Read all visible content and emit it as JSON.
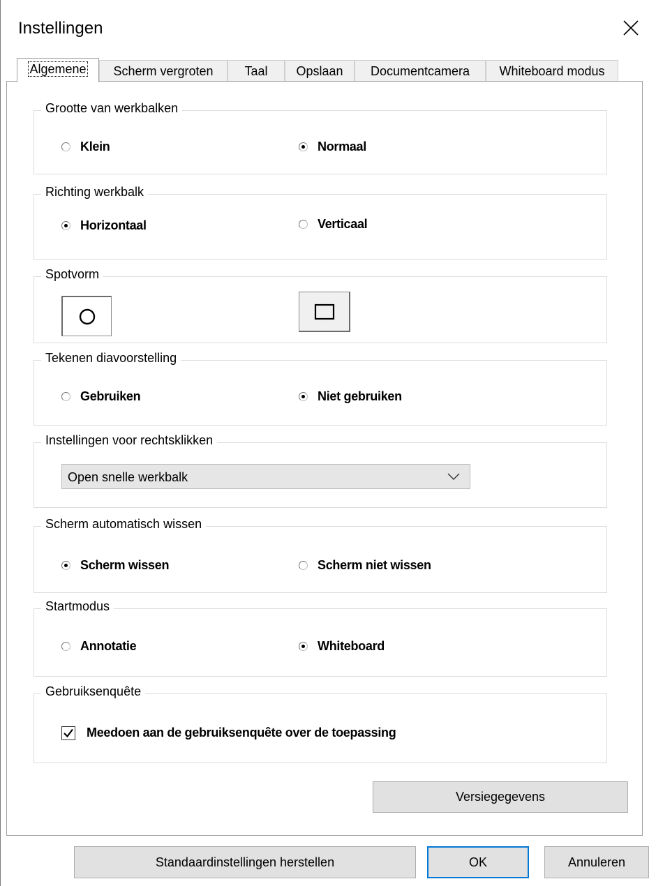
{
  "window": {
    "title": "Instellingen"
  },
  "tabs": [
    {
      "label": "Algemene",
      "active": true
    },
    {
      "label": "Scherm vergroten"
    },
    {
      "label": "Taal"
    },
    {
      "label": "Opslaan"
    },
    {
      "label": "Documentcamera"
    },
    {
      "label": "Whiteboard modus"
    }
  ],
  "groups": {
    "toolbar_size": {
      "legend": "Grootte van werkbalken",
      "options": [
        {
          "label": "Klein",
          "selected": false
        },
        {
          "label": "Normaal",
          "selected": true
        }
      ]
    },
    "toolbar_direction": {
      "legend": "Richting werkbalk",
      "options": [
        {
          "label": "Horizontaal",
          "selected": true
        },
        {
          "label": "Verticaal",
          "selected": false
        }
      ]
    },
    "spot_shape": {
      "legend": "Spotvorm",
      "options": [
        {
          "icon": "circle-icon",
          "selected": true
        },
        {
          "icon": "square-icon",
          "selected": false
        }
      ]
    },
    "slideshow_drawing": {
      "legend": "Tekenen diavoorstelling",
      "options": [
        {
          "label": "Gebruiken",
          "selected": false
        },
        {
          "label": "Niet gebruiken",
          "selected": true
        }
      ]
    },
    "right_click": {
      "legend": "Instellingen voor rechtsklikken",
      "selected": "Open snelle werkbalk"
    },
    "auto_clear": {
      "legend": "Scherm automatisch wissen",
      "options": [
        {
          "label": "Scherm wissen",
          "selected": true
        },
        {
          "label": "Scherm niet wissen",
          "selected": false
        }
      ]
    },
    "start_mode": {
      "legend": "Startmodus",
      "options": [
        {
          "label": "Annotatie",
          "selected": false
        },
        {
          "label": "Whiteboard",
          "selected": true
        }
      ]
    },
    "survey": {
      "legend": "Gebruiksenquête",
      "checkbox_label": "Meedoen aan de gebruiksenquête over de toepassing",
      "checked": true
    }
  },
  "buttons": {
    "version": "Versiegegevens",
    "defaults": "Standaardinstellingen herstellen",
    "ok": "OK",
    "cancel": "Annuleren"
  },
  "colors": {
    "accent": "#0078d7",
    "button_bg": "#e1e1e1",
    "tab_bg": "#f0f0f0"
  }
}
